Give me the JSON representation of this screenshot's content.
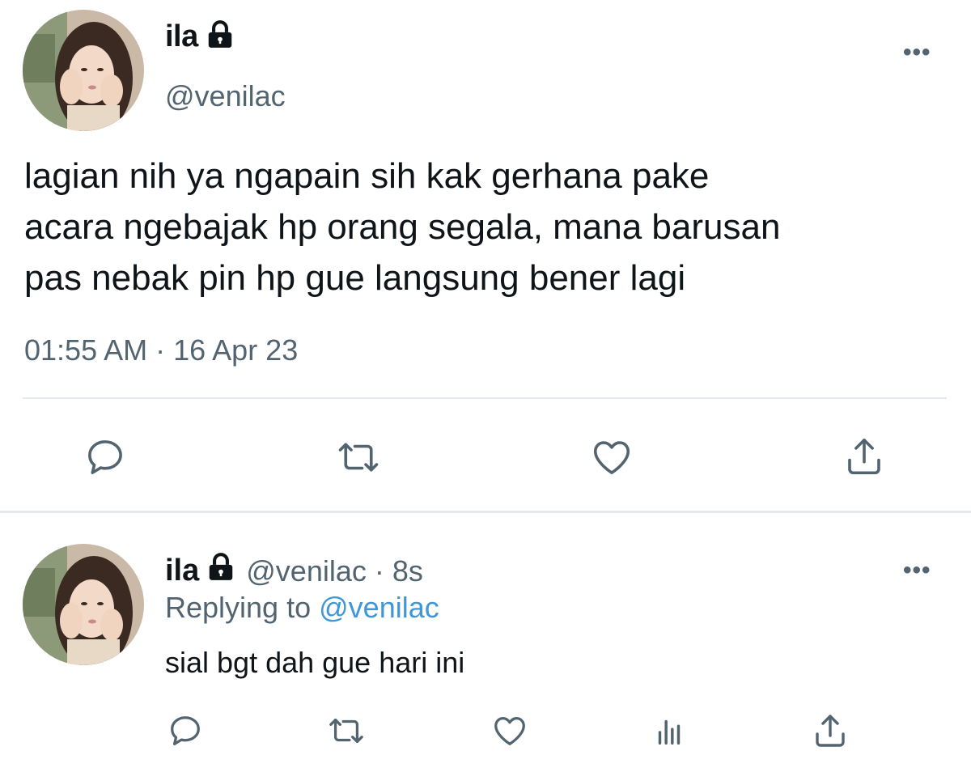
{
  "main_tweet": {
    "display_name": "ila",
    "handle": "@venilac",
    "text_lines": [
      "lagian nih ya ngapain sih kak gerhana pake",
      "acara ngebajak hp orang segala, mana barusan",
      "pas nebak pin hp gue langsung bener lagi"
    ],
    "timestamp": "01:55 AM · 16 Apr 23",
    "more_label": "•••",
    "actions": [
      "reply-icon",
      "retweet-icon",
      "like-icon",
      "share-icon"
    ]
  },
  "reply_tweet": {
    "display_name": "ila",
    "handle": "@venilac",
    "separator": "·",
    "age": "8s",
    "replying_prefix": "Replying to",
    "replying_handle": "@venilac",
    "text": "sial bgt dah gue hari ini",
    "more_label": "•••",
    "actions": [
      "reply-icon",
      "retweet-icon",
      "like-icon",
      "analytics-icon",
      "share-icon"
    ]
  },
  "colors": {
    "text_primary": "#0f1419",
    "text_secondary": "#536471",
    "link": "#3f97d8",
    "divider": "#e6e9ec"
  }
}
